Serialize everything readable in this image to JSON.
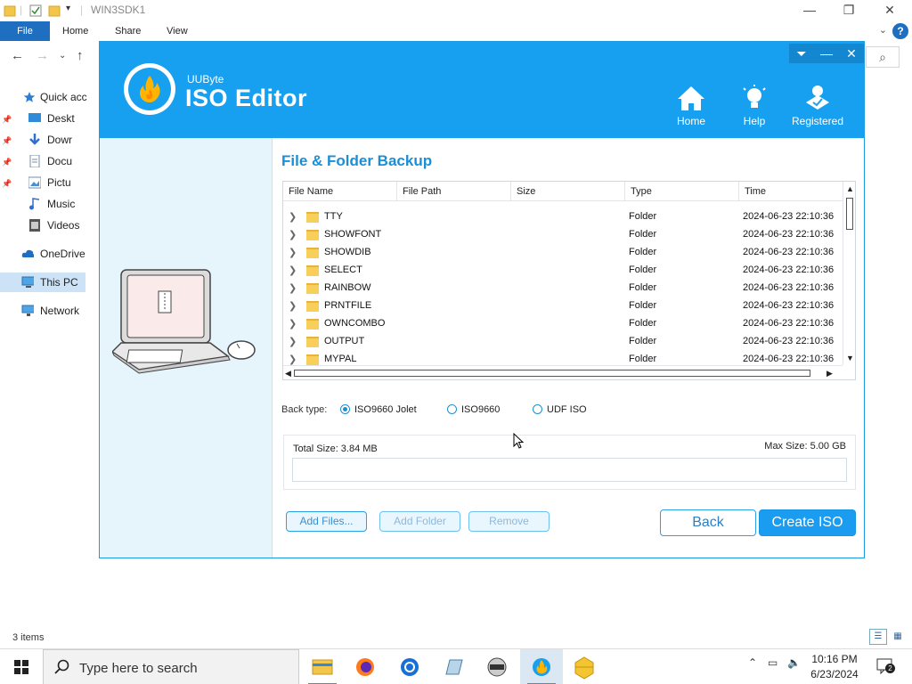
{
  "explorer": {
    "title": "WIN3SDK1",
    "tabs": [
      "File",
      "Home",
      "Share",
      "View"
    ],
    "nav_items": [
      {
        "label": "Quick acc",
        "icon": "star-icon",
        "pinned": false
      },
      {
        "label": "Deskt",
        "icon": "desktop-icon",
        "pinned": true
      },
      {
        "label": "Dowr",
        "icon": "download-icon",
        "pinned": true
      },
      {
        "label": "Docu",
        "icon": "document-icon",
        "pinned": true
      },
      {
        "label": "Pictu",
        "icon": "picture-icon",
        "pinned": true
      },
      {
        "label": "Music",
        "icon": "music-icon",
        "pinned": false
      },
      {
        "label": "Videos",
        "icon": "video-icon",
        "pinned": false
      },
      {
        "label": "OneDrive",
        "icon": "cloud-icon",
        "pinned": false
      },
      {
        "label": "This PC",
        "icon": "computer-icon",
        "pinned": false
      },
      {
        "label": "Network",
        "icon": "network-icon",
        "pinned": false
      }
    ],
    "status": "3 items"
  },
  "app": {
    "brand_small": "UUByte",
    "brand_big": "ISO Editor",
    "header_buttons": [
      "Home",
      "Help",
      "Registered"
    ],
    "panel_title": "File & Folder Backup",
    "columns": [
      "File Name",
      "File Path",
      "Size",
      "Type",
      "Time"
    ],
    "rows": [
      {
        "name": "TTY",
        "path": "",
        "size": "",
        "type": "Folder",
        "time": "2024-06-23 22:10:36"
      },
      {
        "name": "SHOWFONT",
        "path": "",
        "size": "",
        "type": "Folder",
        "time": "2024-06-23 22:10:36"
      },
      {
        "name": "SHOWDIB",
        "path": "",
        "size": "",
        "type": "Folder",
        "time": "2024-06-23 22:10:36"
      },
      {
        "name": "SELECT",
        "path": "",
        "size": "",
        "type": "Folder",
        "time": "2024-06-23 22:10:36"
      },
      {
        "name": "RAINBOW",
        "path": "",
        "size": "",
        "type": "Folder",
        "time": "2024-06-23 22:10:36"
      },
      {
        "name": "PRNTFILE",
        "path": "",
        "size": "",
        "type": "Folder",
        "time": "2024-06-23 22:10:36"
      },
      {
        "name": "OWNCOMBO",
        "path": "",
        "size": "",
        "type": "Folder",
        "time": "2024-06-23 22:10:36"
      },
      {
        "name": "OUTPUT",
        "path": "",
        "size": "",
        "type": "Folder",
        "time": "2024-06-23 22:10:36"
      },
      {
        "name": "MYPAL",
        "path": "",
        "size": "",
        "type": "Folder",
        "time": "2024-06-23 22:10:36"
      }
    ],
    "back_type_label": "Back type:",
    "back_types": [
      {
        "label": "ISO9660 Jolet",
        "selected": true
      },
      {
        "label": "ISO9660",
        "selected": false
      },
      {
        "label": "UDF ISO",
        "selected": false
      }
    ],
    "total_size": "Total Size: 3.84 MB",
    "max_size": "Max Size: 5.00 GB",
    "buttons": {
      "add_files": "Add Files...",
      "add_folder": "Add Folder",
      "remove": "Remove",
      "back": "Back",
      "create_iso": "Create ISO"
    },
    "accent_color": "#18a0f0"
  },
  "taskbar": {
    "search_placeholder": "Type here to search",
    "time": "10:16 PM",
    "date": "6/23/2024",
    "notification_count": "2",
    "pinned_apps": [
      "file-explorer-icon",
      "firefox-icon",
      "chrome-icon",
      "notepad-icon",
      "cd-burner-icon",
      "app-icon",
      "uubyte-icon"
    ]
  }
}
